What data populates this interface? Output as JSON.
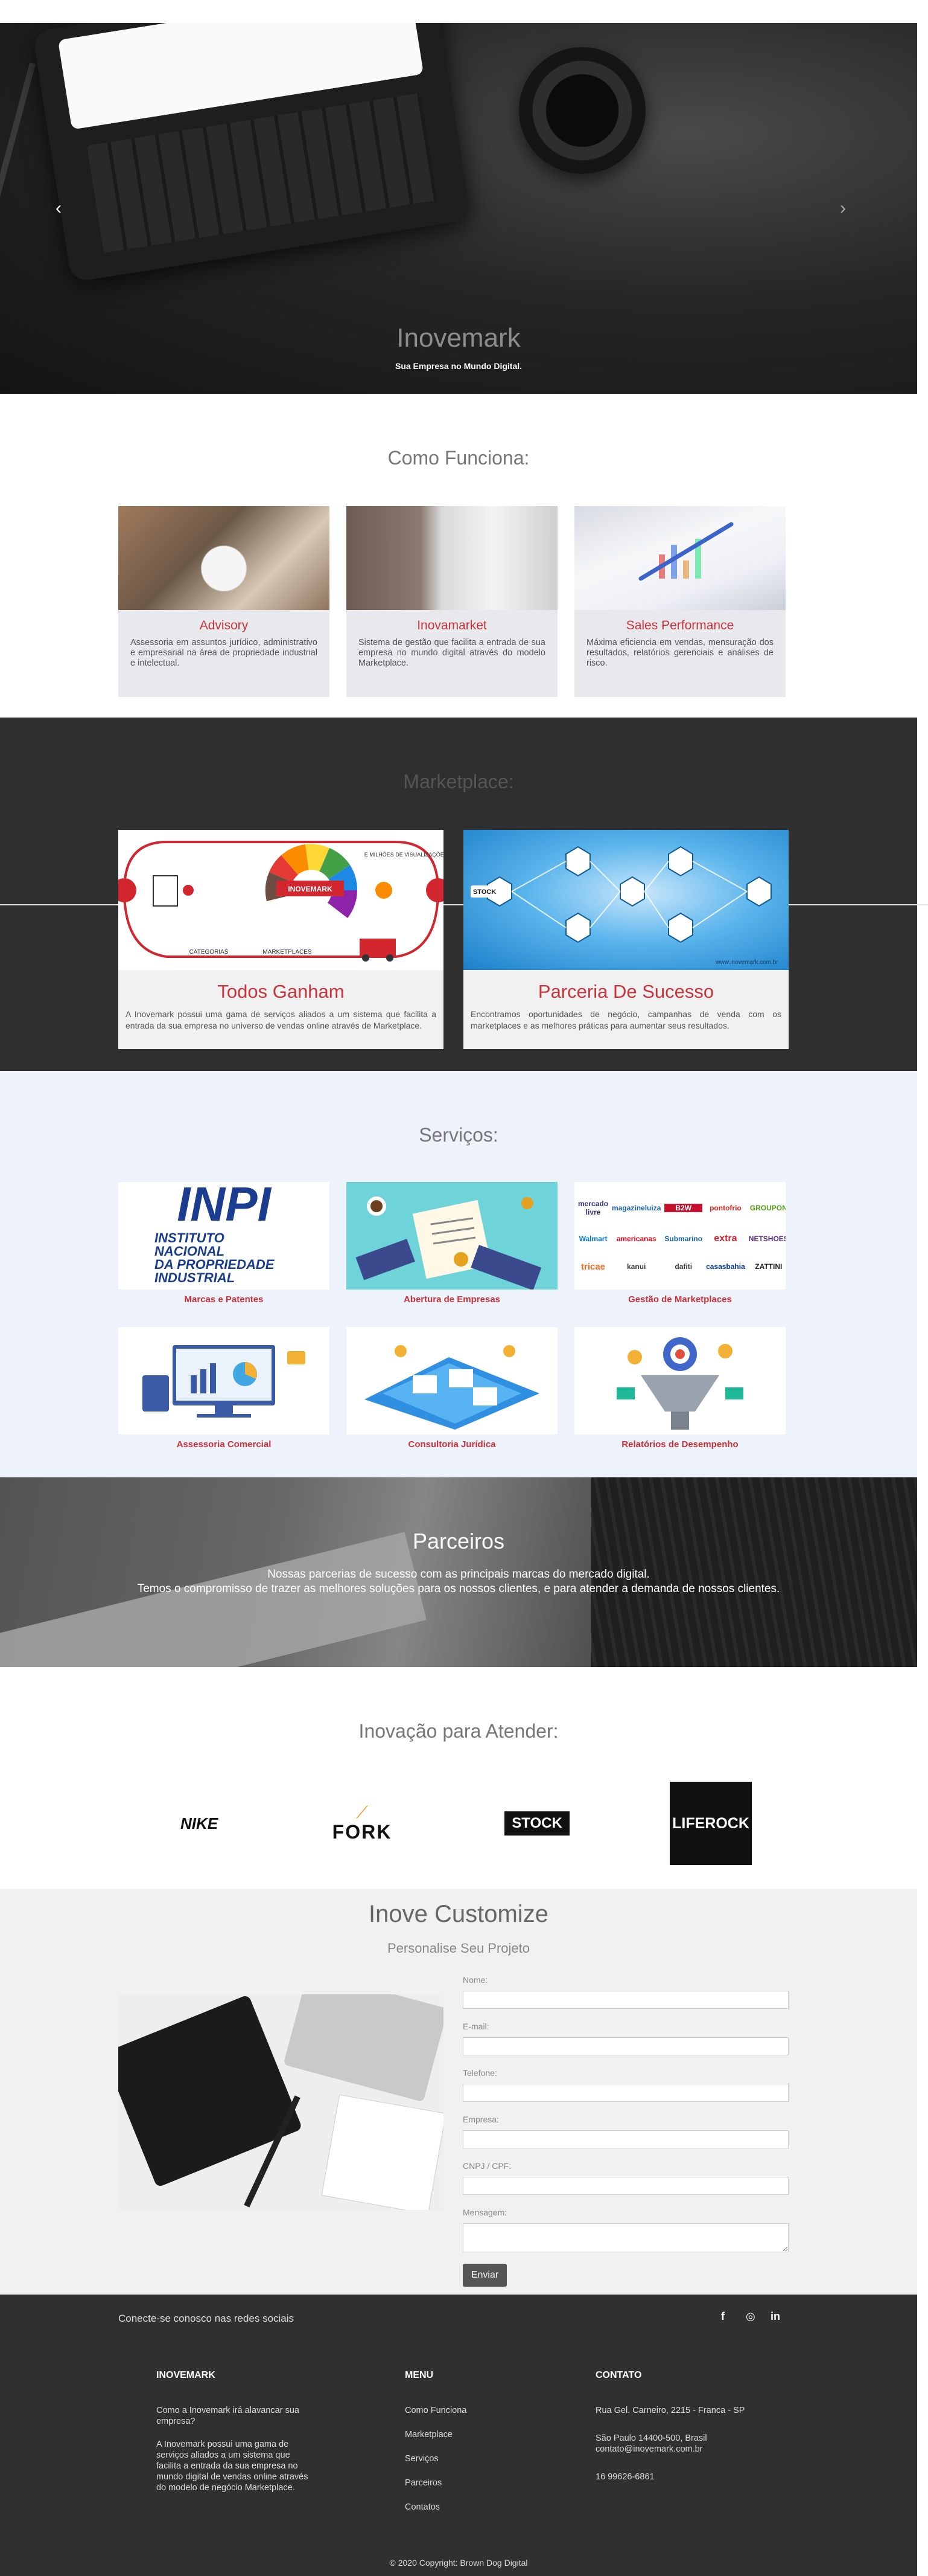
{
  "hero": {
    "title": "Inovemark",
    "subtitle": "Sua Empresa no Mundo Digital.",
    "prev_arrow": "‹",
    "next_arrow": "›"
  },
  "como_funciona": {
    "title": "Como Funciona:",
    "cards": [
      {
        "title": "Advisory",
        "text": "Assessoria em assuntos jurídico, administrativo e empresarial na área de propriedade industrial e intelectual."
      },
      {
        "title": "Inovamarket",
        "text": "Sistema de gestão que facilita a entrada de sua empresa no mundo digital através do modelo Marketplace."
      },
      {
        "title": "Sales Performance",
        "text": "Máxima eficiencia em vendas, mensuração dos resultados, relatórios gerenciais e análises de risco."
      }
    ]
  },
  "marketplace": {
    "title": "Marketplace:",
    "cards": [
      {
        "title": "Todos Ganham",
        "text": "A Inovemark possui uma gama de serviços aliados a um sistema que facilita a entrada da sua empresa no universo de vendas online através de Marketplace.",
        "img_labels": {
          "brand": "INOVEMARK",
          "categorias": "CATEGORIAS",
          "marketplaces": "MARKETPLACES",
          "top": "E MILHÕES DE VISUALIZAÇÕES / DIA"
        }
      },
      {
        "title": "Parceria De Sucesso",
        "text": "Encontramos oportunidades de negócio, campanhas de venda com os marketplaces e as melhores práticas para aumentar seus resultados.",
        "img_labels": {
          "stock": "STOCK",
          "site": "www.inovemark.com.br"
        }
      }
    ]
  },
  "servicos": {
    "title": "Serviços:",
    "items": [
      {
        "label": "Marcas e Patentes"
      },
      {
        "label": "Abertura de Empresas"
      },
      {
        "label": "Gestão de Marketplaces"
      },
      {
        "label": "Assessoria Comercial"
      },
      {
        "label": "Consultoria Jurídica"
      },
      {
        "label": "Relatórios de Desempenho"
      }
    ],
    "inpi": {
      "big": "INPI",
      "l1": "INSTITUTO",
      "l2": "NACIONAL",
      "l3": "DA PROPRIEDADE",
      "l4": "INDUSTRIAL"
    },
    "marketplace_logos": [
      "mercado livre",
      "magazineluiza",
      "B2W",
      "pontofrio",
      "GROUPON",
      "Walmart",
      "americanas",
      "Submarino",
      "extra",
      "NETSHOES",
      "tricae",
      "kanui",
      "dafiti",
      "casasbahia",
      "ZATTINI"
    ]
  },
  "parceiros": {
    "title": "Parceiros",
    "line1": "Nossas parcerias de sucesso com as principais marcas do mercado digital.",
    "line2": "Temos o compromisso de trazer as melhores soluções para os nossos clientes, e para atender a demanda de nossos clientes."
  },
  "inovacao": {
    "title": "Inovação para Atender:",
    "logos": [
      {
        "name": "NIKE"
      },
      {
        "name": "FORK"
      },
      {
        "name": "STOCK"
      },
      {
        "name": "LIFEROCK"
      }
    ]
  },
  "customize": {
    "title": "Inove Customize",
    "subtitle": "Personalise Seu Projeto",
    "fields": [
      {
        "label": "Nome:"
      },
      {
        "label": "E-mail:"
      },
      {
        "label": "Telefone:"
      },
      {
        "label": "Empresa:"
      },
      {
        "label": "CNPJ / CPF:"
      },
      {
        "label": "Mensagem:"
      }
    ],
    "submit": "Enviar"
  },
  "social": {
    "text": "Conecte-se conosco nas redes sociais",
    "icons": [
      "f",
      "◎",
      "in"
    ]
  },
  "footer": {
    "col1": {
      "heading": "INOVEMARK",
      "q": "Como a Inovemark irá alavancar sua empresa?",
      "a": "A Inovemark possui uma gama de serviços aliados a um sistema que facilita a entrada da sua empresa no mundo digital de vendas online através do modelo de negócio Marketplace."
    },
    "col2": {
      "heading": "MENU",
      "links": [
        "Como Funciona",
        "Marketplace",
        "Serviços",
        "Parceiros",
        "Contatos"
      ]
    },
    "col3": {
      "heading": "CONTATO",
      "address1": "Rua Gel. Carneiro, 2215 - Franca - SP",
      "address2": "São Paulo 14400-500, Brasil",
      "email": "contato@inovemark.com.br",
      "phone": "16 99626-6861"
    },
    "copyright": "© 2020 Copyright: Brown Dog Digital"
  }
}
